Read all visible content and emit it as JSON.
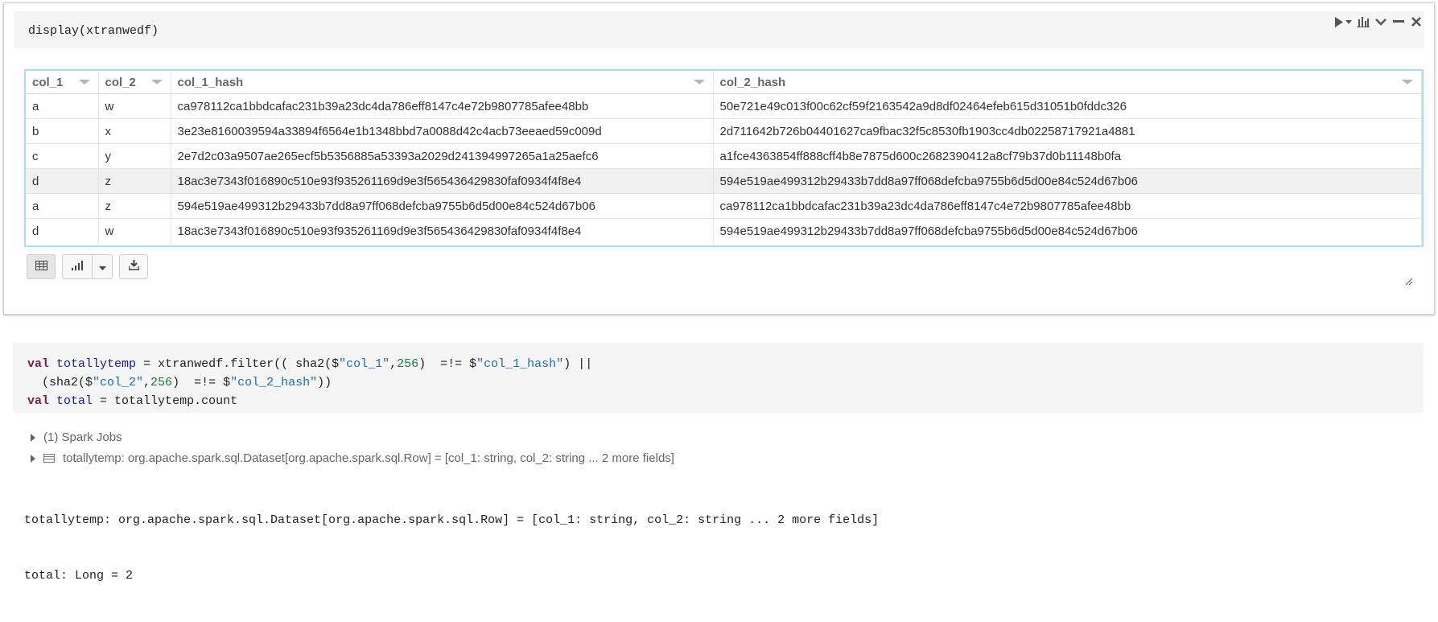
{
  "cell1": {
    "code": "display(xtranwedf)",
    "table": {
      "columns": [
        "col_1",
        "col_2",
        "col_1_hash",
        "col_2_hash"
      ],
      "rows": [
        [
          "a",
          "w",
          "ca978112ca1bbdcafac231b39a23dc4da786eff8147c4e72b9807785afee48bb",
          "50e721e49c013f00c62cf59f2163542a9d8df02464efeb615d31051b0fddc326"
        ],
        [
          "b",
          "x",
          "3e23e8160039594a33894f6564e1b1348bbd7a0088d42c4acb73eeaed59c009d",
          "2d711642b726b04401627ca9fbac32f5c8530fb1903cc4db02258717921a4881"
        ],
        [
          "c",
          "y",
          "2e7d2c03a9507ae265ecf5b5356885a53393a2029d241394997265a1a25aefc6",
          "a1fce4363854ff888cff4b8e7875d600c2682390412a8cf79b37d0b11148b0fa"
        ],
        [
          "d",
          "z",
          "18ac3e7343f016890c510e93f935261169d9e3f565436429830faf0934f4f8e4",
          "594e519ae499312b29433b7dd8a97ff068defcba9755b6d5d00e84c524d67b06"
        ],
        [
          "a",
          "z",
          "594e519ae499312b29433b7dd8a97ff068defcba9755b6d5d00e84c524d67b06",
          "ca978112ca1bbdcafac231b39a23dc4da786eff8147c4e72b9807785afee48bb"
        ],
        [
          "d",
          "w",
          "18ac3e7343f016890c510e93f935261169d9e3f565436429830faf0934f4f8e4",
          "594e519ae499312b29433b7dd8a97ff068defcba9755b6d5d00e84c524d67b06"
        ]
      ],
      "highlighted_row_index": 3
    },
    "toolbar_icons": [
      "run-icon",
      "run-dropdown-icon",
      "chart-icon",
      "collapse-icon",
      "minimize-icon",
      "close-icon"
    ],
    "view_buttons": [
      "table-icon",
      "bar-chart-icon",
      "dropdown-caret-icon",
      "download-icon"
    ]
  },
  "cell2": {
    "code_lines": [
      [
        {
          "t": "val",
          "c": "kw"
        },
        {
          "t": " "
        },
        {
          "t": "totallytemp",
          "c": "var"
        },
        {
          "t": " = xtranwedf.filter(( sha2($"
        },
        {
          "t": "\"col_1\"",
          "c": "str"
        },
        {
          "t": ","
        },
        {
          "t": "256",
          "c": "num"
        },
        {
          "t": ")  =!= $"
        },
        {
          "t": "\"col_1_hash\"",
          "c": "str"
        },
        {
          "t": ") ||"
        }
      ],
      [
        {
          "t": "  (sha2($"
        },
        {
          "t": "\"col_2\"",
          "c": "str"
        },
        {
          "t": ","
        },
        {
          "t": "256",
          "c": "num"
        },
        {
          "t": ")  =!= $"
        },
        {
          "t": "\"col_2_hash\"",
          "c": "str"
        },
        {
          "t": "))"
        }
      ],
      [
        {
          "t": "val",
          "c": "kw"
        },
        {
          "t": " "
        },
        {
          "t": "total",
          "c": "var"
        },
        {
          "t": " = totallytemp.count"
        }
      ]
    ],
    "spark_jobs": "(1) Spark Jobs",
    "schema_summary": "totallytemp:  org.apache.spark.sql.Dataset[org.apache.spark.sql.Row] = [col_1: string, col_2: string ... 2 more fields]",
    "output_lines": [
      "totallytemp: org.apache.spark.sql.Dataset[org.apache.spark.sql.Row] = [col_1: string, col_2: string ... 2 more fields]",
      "total: Long = 2"
    ]
  }
}
